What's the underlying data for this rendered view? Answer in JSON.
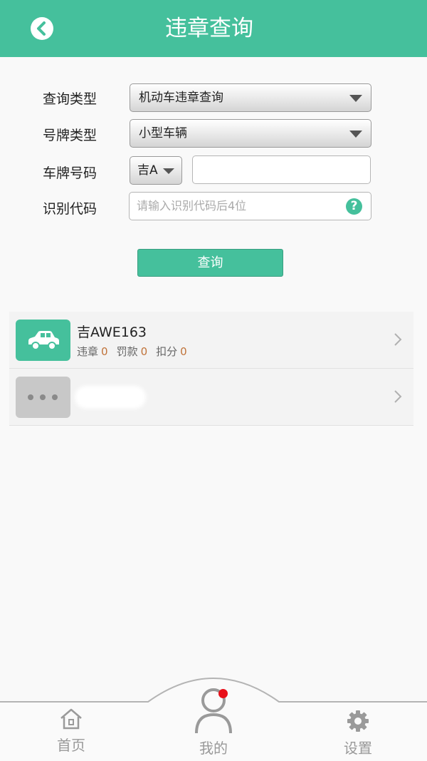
{
  "header": {
    "title": "违章查询",
    "back_icon": "back-arrow-icon"
  },
  "form": {
    "query_type_label": "查询类型",
    "query_type_value": "机动车违章查询",
    "plate_type_label": "号牌类型",
    "plate_type_value": "小型车辆",
    "plate_number_label": "车牌号码",
    "plate_prefix_value": "吉A",
    "plate_number_value": "",
    "vin_label": "识别代码",
    "vin_placeholder": "请输入识别代码后4位",
    "help_icon_text": "?"
  },
  "query_button": "查询",
  "vehicles": [
    {
      "plate": "吉AWE163",
      "violations_label": "违章",
      "violations": "0",
      "fines_label": "罚款",
      "fines": "0",
      "points_label": "扣分",
      "points": "0",
      "icon": "car-icon"
    },
    {
      "icon": "more-dots-icon"
    }
  ],
  "nav": {
    "home": "首页",
    "mine": "我的",
    "settings": "设置"
  },
  "colors": {
    "accent": "#45c09c",
    "stat_number": "#c0733a",
    "notification_dot": "#e8101a"
  }
}
